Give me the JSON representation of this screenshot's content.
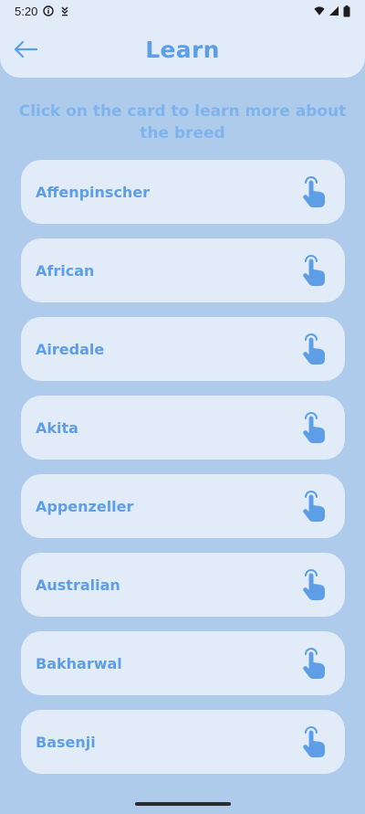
{
  "status_bar": {
    "time": "5:20",
    "icons_left": [
      "info-icon",
      "download-icon"
    ],
    "icons_right": [
      "wifi-icon",
      "signal-icon",
      "battery-icon"
    ]
  },
  "app_bar": {
    "title": "Learn",
    "back_icon": "back-arrow-icon"
  },
  "hint": "Click on the card to learn more about the breed",
  "breeds": [
    {
      "label": "Affenpinscher",
      "icon": "tap-hand-icon"
    },
    {
      "label": "African",
      "icon": "tap-hand-icon"
    },
    {
      "label": "Airedale",
      "icon": "tap-hand-icon"
    },
    {
      "label": "Akita",
      "icon": "tap-hand-icon"
    },
    {
      "label": "Appenzeller",
      "icon": "tap-hand-icon"
    },
    {
      "label": "Australian",
      "icon": "tap-hand-icon"
    },
    {
      "label": "Bakharwal",
      "icon": "tap-hand-icon"
    },
    {
      "label": "Basenji",
      "icon": "tap-hand-icon"
    }
  ],
  "colors": {
    "background": "#aecbec",
    "panel": "#e2ecf8",
    "accent": "#5e9ee6",
    "hint": "#7eb4ee"
  }
}
